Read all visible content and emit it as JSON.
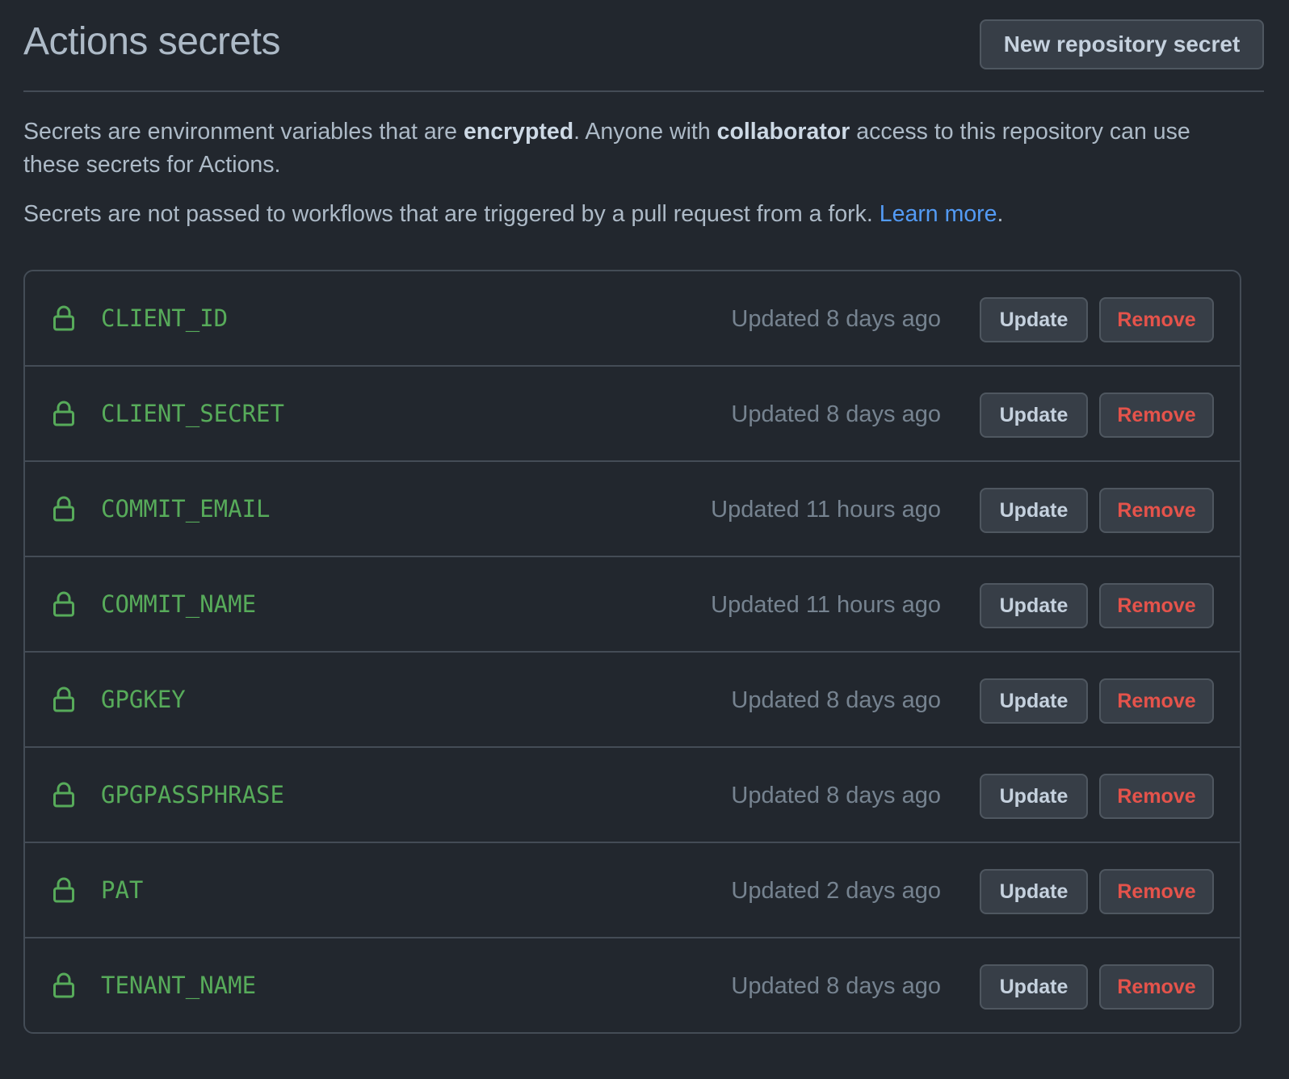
{
  "header": {
    "title": "Actions secrets",
    "new_button_label": "New repository secret"
  },
  "description": {
    "p1_part1": "Secrets are environment variables that are ",
    "p1_bold1": "encrypted",
    "p1_part2": ". Anyone with ",
    "p1_bold2": "collaborator",
    "p1_part3": " access to this repository can use these secrets for Actions.",
    "p2_text": "Secrets are not passed to workflows that are triggered by a pull request from a fork. ",
    "p2_link": "Learn more",
    "p2_end": "."
  },
  "secrets": [
    {
      "name": "CLIENT_ID",
      "updated": "Updated 8 days ago",
      "update_label": "Update",
      "remove_label": "Remove"
    },
    {
      "name": "CLIENT_SECRET",
      "updated": "Updated 8 days ago",
      "update_label": "Update",
      "remove_label": "Remove"
    },
    {
      "name": "COMMIT_EMAIL",
      "updated": "Updated 11 hours ago",
      "update_label": "Update",
      "remove_label": "Remove"
    },
    {
      "name": "COMMIT_NAME",
      "updated": "Updated 11 hours ago",
      "update_label": "Update",
      "remove_label": "Remove"
    },
    {
      "name": "GPGKEY",
      "updated": "Updated 8 days ago",
      "update_label": "Update",
      "remove_label": "Remove"
    },
    {
      "name": "GPGPASSPHRASE",
      "updated": "Updated 8 days ago",
      "update_label": "Update",
      "remove_label": "Remove"
    },
    {
      "name": "PAT",
      "updated": "Updated 2 days ago",
      "update_label": "Update",
      "remove_label": "Remove"
    },
    {
      "name": "TENANT_NAME",
      "updated": "Updated 8 days ago",
      "update_label": "Update",
      "remove_label": "Remove"
    }
  ],
  "icons": {
    "secret_icon": "lock-icon"
  },
  "colors": {
    "background": "#22272e",
    "secret_name": "#57ab5a",
    "link": "#539bf5",
    "danger": "#e5534b",
    "muted": "#768390"
  }
}
